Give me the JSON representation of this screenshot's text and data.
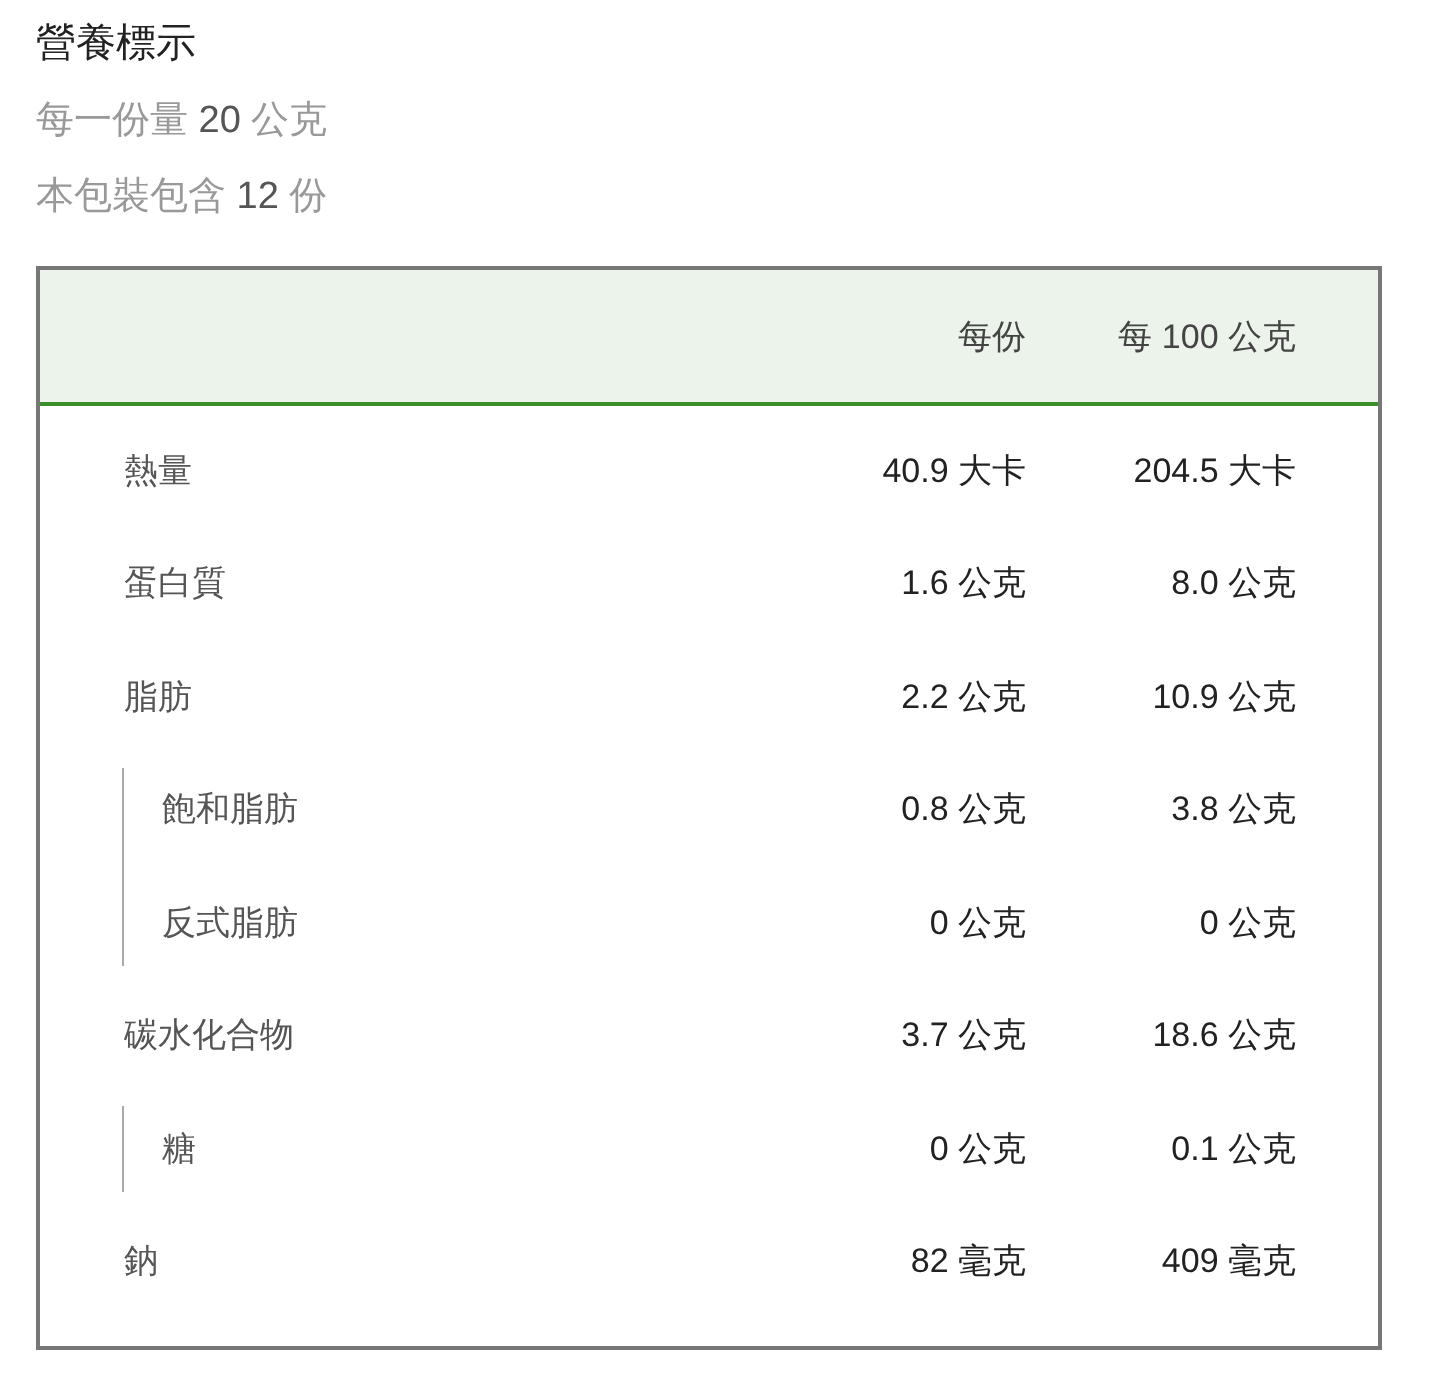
{
  "title": "營養標示",
  "serving_size": {
    "label": "每一份量",
    "value": "20",
    "unit": "公克"
  },
  "servings_per_package": {
    "label": "本包裝包含",
    "value": "12",
    "unit": "份"
  },
  "table": {
    "columns": [
      "每份",
      "每 100 公克"
    ],
    "rows": [
      {
        "name": "熱量",
        "per_serving": "40.9 大卡",
        "per_100g": "204.5 大卡"
      },
      {
        "name": "蛋白質",
        "per_serving": "1.6 公克",
        "per_100g": "8.0 公克"
      },
      {
        "name": "脂肪",
        "per_serving": "2.2 公克",
        "per_100g": "10.9 公克",
        "children": [
          {
            "name": "飽和脂肪",
            "per_serving": "0.8 公克",
            "per_100g": "3.8 公克"
          },
          {
            "name": "反式脂肪",
            "per_serving": "0 公克",
            "per_100g": "0 公克"
          }
        ]
      },
      {
        "name": "碳水化合物",
        "per_serving": "3.7 公克",
        "per_100g": "18.6 公克",
        "children": [
          {
            "name": "糖",
            "per_serving": "0 公克",
            "per_100g": "0.1 公克"
          }
        ]
      },
      {
        "name": "鈉",
        "per_serving": "82 毫克",
        "per_100g": "409 毫克"
      }
    ]
  }
}
